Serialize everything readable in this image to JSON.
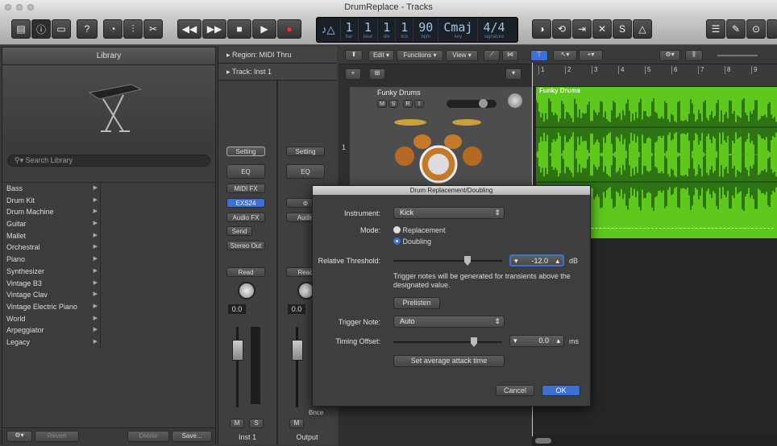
{
  "window": {
    "title": "DrumReplace - Tracks"
  },
  "lcd": {
    "bar": "1",
    "beat": "1",
    "div": "1",
    "tick": "1",
    "bpm": "90",
    "key": "Cmaj",
    "signature": "4/4",
    "labels": {
      "bar": "bar",
      "beat": "beat",
      "div": "div",
      "tick": "tick",
      "bpm": "bpm",
      "key": "key",
      "signature": "signature"
    }
  },
  "library": {
    "title": "Library",
    "search_placeholder": "Search Library",
    "items": [
      "Bass",
      "Drum Kit",
      "Drum Machine",
      "Guitar",
      "Mallet",
      "Orchestral",
      "Piano",
      "Synthesizer",
      "Vintage B3",
      "Vintage Clav",
      "Vintage Electric Piano",
      "World",
      "Arpeggiator",
      "Legacy"
    ],
    "revert": "Revert",
    "delete": "Delete",
    "save": "Save..."
  },
  "inspector": {
    "region": "Region: MIDI Thru",
    "track": "Track: Inst 1",
    "strip1": {
      "setting": "Setting",
      "eq": "EQ",
      "midi_fx": "MIDI FX",
      "instrument": "EXS24",
      "audio_fx": "Audio FX",
      "send": "Send",
      "output": "Stereo Out",
      "automation": "Read",
      "pan_value": "0.0",
      "mute": "M",
      "solo": "S",
      "name": "Inst 1"
    },
    "strip2": {
      "setting": "Setting",
      "eq": "EQ",
      "audio_fx": "Audio",
      "automation": "Read",
      "pan_value": "0.0",
      "bounce": "Bnce",
      "mute": "M",
      "name": "Output"
    }
  },
  "tracks": {
    "menus": [
      "Edit",
      "Functions",
      "View"
    ],
    "ruler": [
      "1",
      "2",
      "3",
      "4",
      "5",
      "6",
      "7",
      "8",
      "9"
    ],
    "track": {
      "number": "1",
      "name": "Funky Drums",
      "buttons": [
        "M",
        "S",
        "R",
        "I"
      ]
    },
    "region": {
      "name": "Funky Drums"
    }
  },
  "dialog": {
    "title": "Drum Replacement/Doubling",
    "instrument_label": "Instrument:",
    "instrument": "Kick",
    "mode_label": "Mode:",
    "mode_options": [
      "Replacement",
      "Doubling"
    ],
    "mode_selected": "Doubling",
    "threshold_label": "Relative Threshold:",
    "threshold": "-12.0",
    "threshold_unit": "dB",
    "threshold_fraction": 0.6,
    "hint": "Trigger notes will be generated for transients above the designated value.",
    "prelisten": "Prelisten",
    "trigger_label": "Trigger Note:",
    "trigger": "Auto",
    "offset_label": "Timing Offset:",
    "offset": "0.0",
    "offset_unit": "ms",
    "offset_fraction": 0.6,
    "avg_attack": "Set average attack time",
    "cancel": "Cancel",
    "ok": "OK"
  },
  "colors": {
    "accent": "#3d6fd6",
    "region": "#5fc81c",
    "waveform": "#0f3b0f"
  }
}
